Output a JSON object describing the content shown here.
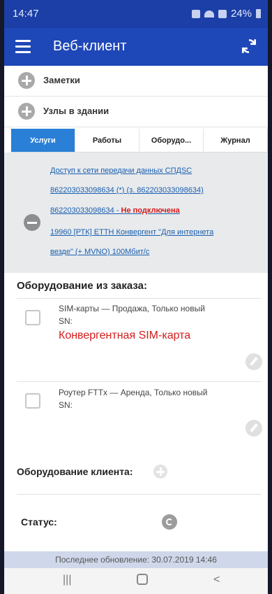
{
  "status_bar": {
    "time": "14:47",
    "battery": "24%"
  },
  "app_bar": {
    "title": "Веб-клиент"
  },
  "sections": {
    "notes": "Заметки",
    "nodes": "Узлы в здании"
  },
  "tabs": [
    {
      "label": "Услуги",
      "active": true
    },
    {
      "label": "Работы",
      "active": false
    },
    {
      "label": "Оборудо...",
      "active": false
    },
    {
      "label": "Журнал",
      "active": false
    }
  ],
  "service": {
    "line1": "Доступ к сети передачи данных СПДSC",
    "line2": "862203033098634 (*) (з. 862203033098634)",
    "line3_prefix": "862203033098634 - ",
    "line3_status": "Не подключена",
    "line4": "19960 [РТК] ETTH Конвергент \"Для интернета",
    "line5": "везде\" (+ MVNO) 100Мбит/с"
  },
  "equipment": {
    "title": "Оборудование из заказа:",
    "items": [
      {
        "title": "SIM-карты — Продажа, Только новый",
        "sn_label": "SN:",
        "highlight": "Конвергентная SIM-карта"
      },
      {
        "title": "Роутер FTTx — Аренда, Только новый",
        "sn_label": "SN:",
        "highlight": ""
      }
    ]
  },
  "client": {
    "title": "Оборудование клиента:"
  },
  "status": {
    "label": "Статус:"
  },
  "footer": {
    "updated": "Последнее обновление: 30.07.2019 14:46"
  },
  "nav": {
    "recent": "|||",
    "back": "<"
  },
  "colors": {
    "primary": "#1e47b8",
    "accent": "#2a7fd6",
    "error": "#d41c1c",
    "link": "#1a5fb0"
  }
}
